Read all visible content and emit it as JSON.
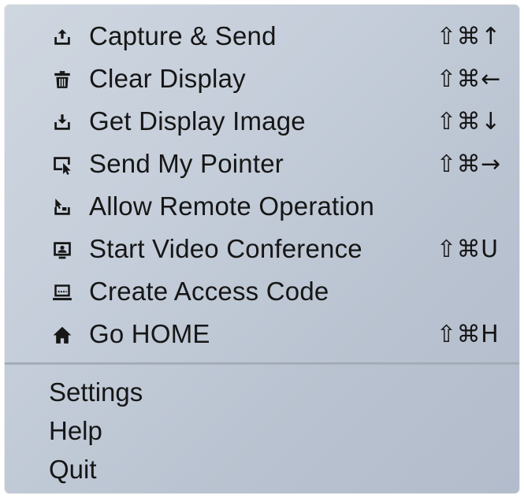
{
  "menu": {
    "items": [
      {
        "label": "Capture & Send",
        "shortcut": "⇧⌘↑",
        "icon": "upload-tray-icon"
      },
      {
        "label": "Clear Display",
        "shortcut": "⇧⌘←",
        "icon": "trash-icon"
      },
      {
        "label": "Get Display Image",
        "shortcut": "⇧⌘↓",
        "icon": "download-tray-icon"
      },
      {
        "label": "Send My Pointer",
        "shortcut": "⇧⌘→",
        "icon": "pointer-screen-icon"
      },
      {
        "label": "Allow Remote Operation",
        "shortcut": "",
        "icon": "remote-operation-icon"
      },
      {
        "label": "Start Video Conference",
        "shortcut": "⇧⌘U",
        "icon": "video-conference-icon"
      },
      {
        "label": "Create Access Code",
        "shortcut": "",
        "icon": "laptop-code-icon"
      },
      {
        "label": "Go HOME",
        "shortcut": "⇧⌘H",
        "icon": "home-icon"
      }
    ],
    "secondary": [
      {
        "label": "Settings"
      },
      {
        "label": "Help"
      },
      {
        "label": "Quit"
      }
    ]
  }
}
